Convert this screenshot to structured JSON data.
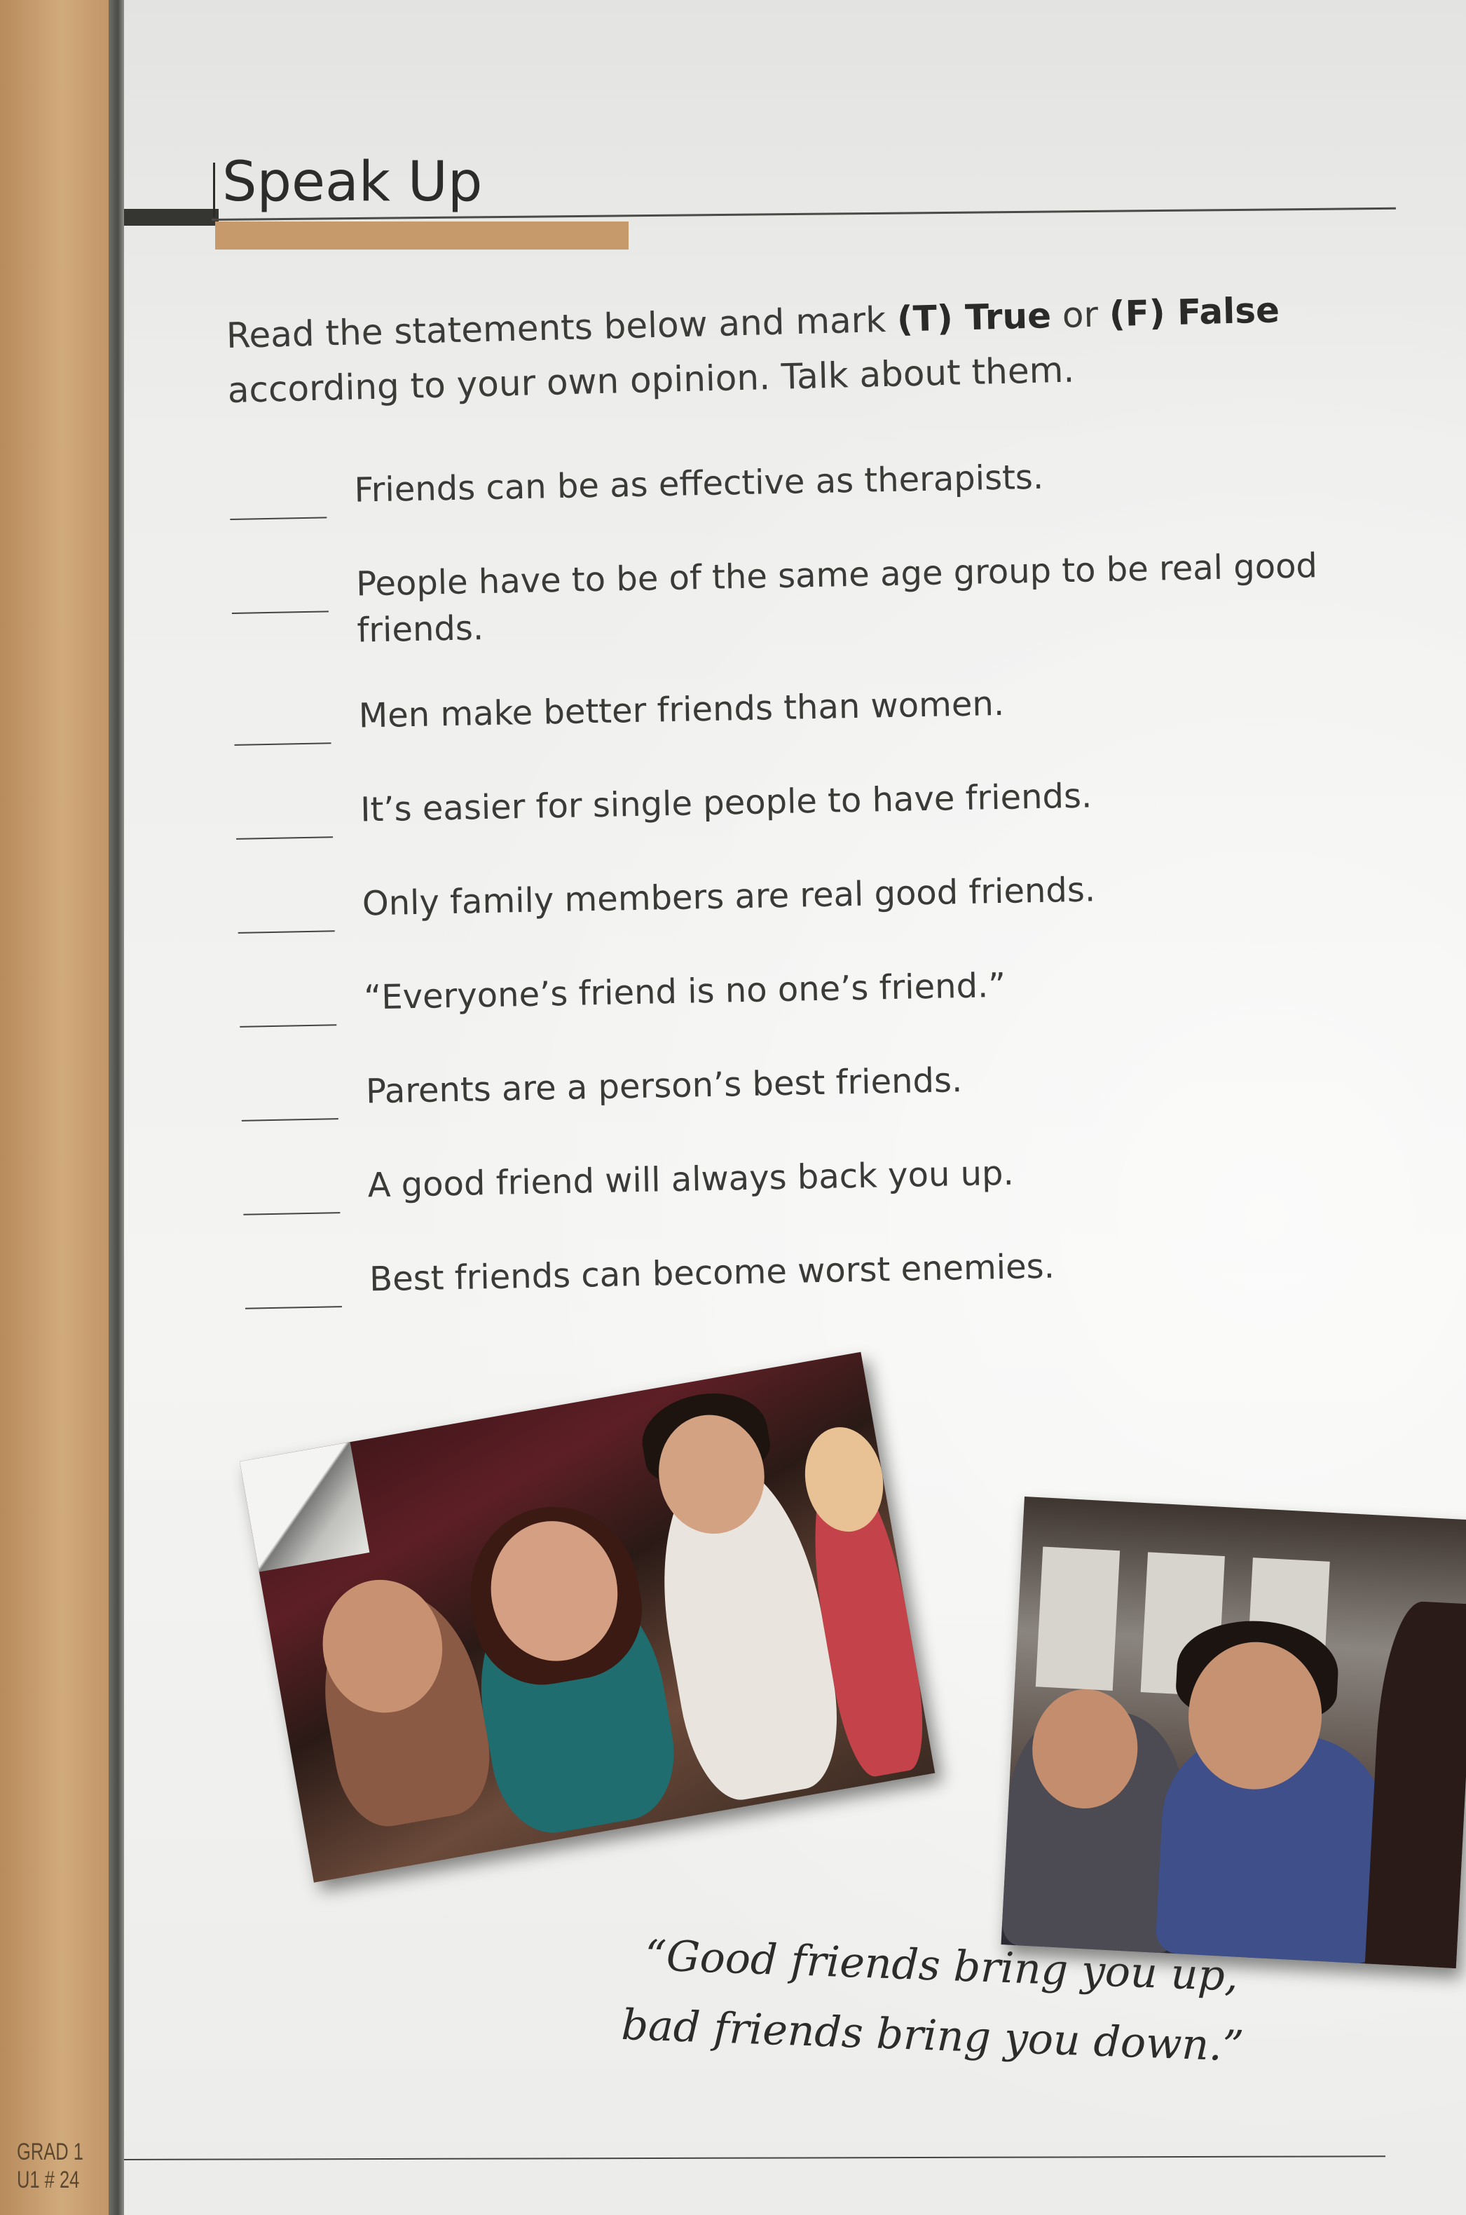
{
  "header": {
    "title": "Speak Up"
  },
  "instructions": {
    "part1": "Read the statements below and mark ",
    "true_label": "(T) True",
    "or": " or ",
    "false_label": "(F) False",
    "part2": " according to your own opinion. Talk about them."
  },
  "statements": [
    {
      "blank": "",
      "text": "Friends can be as effective as therapists."
    },
    {
      "blank": "",
      "text": "People have to be of the same age group to be real good friends."
    },
    {
      "blank": "",
      "text": "Men make better friends than women."
    },
    {
      "blank": "",
      "text": "It’s easier for single people to have friends."
    },
    {
      "blank": "",
      "text": "Only family members are real good friends."
    },
    {
      "blank": "",
      "text": "“Everyone’s friend is no one’s friend.”"
    },
    {
      "blank": "",
      "text": "Parents are a person’s best friends."
    },
    {
      "blank": "",
      "text": "A good friend will always back you up."
    },
    {
      "blank": "",
      "text": "Best friends can become worst enemies."
    }
  ],
  "quote": {
    "line1": "“Good friends bring you up,",
    "line2": "bad friends bring you down.”"
  },
  "footer": {
    "line1": "GRAD 1",
    "line2": "U1 # 24"
  },
  "colors": {
    "accent": "#c79a6b",
    "spine": "#c9a37a",
    "text": "#3a3a37"
  }
}
